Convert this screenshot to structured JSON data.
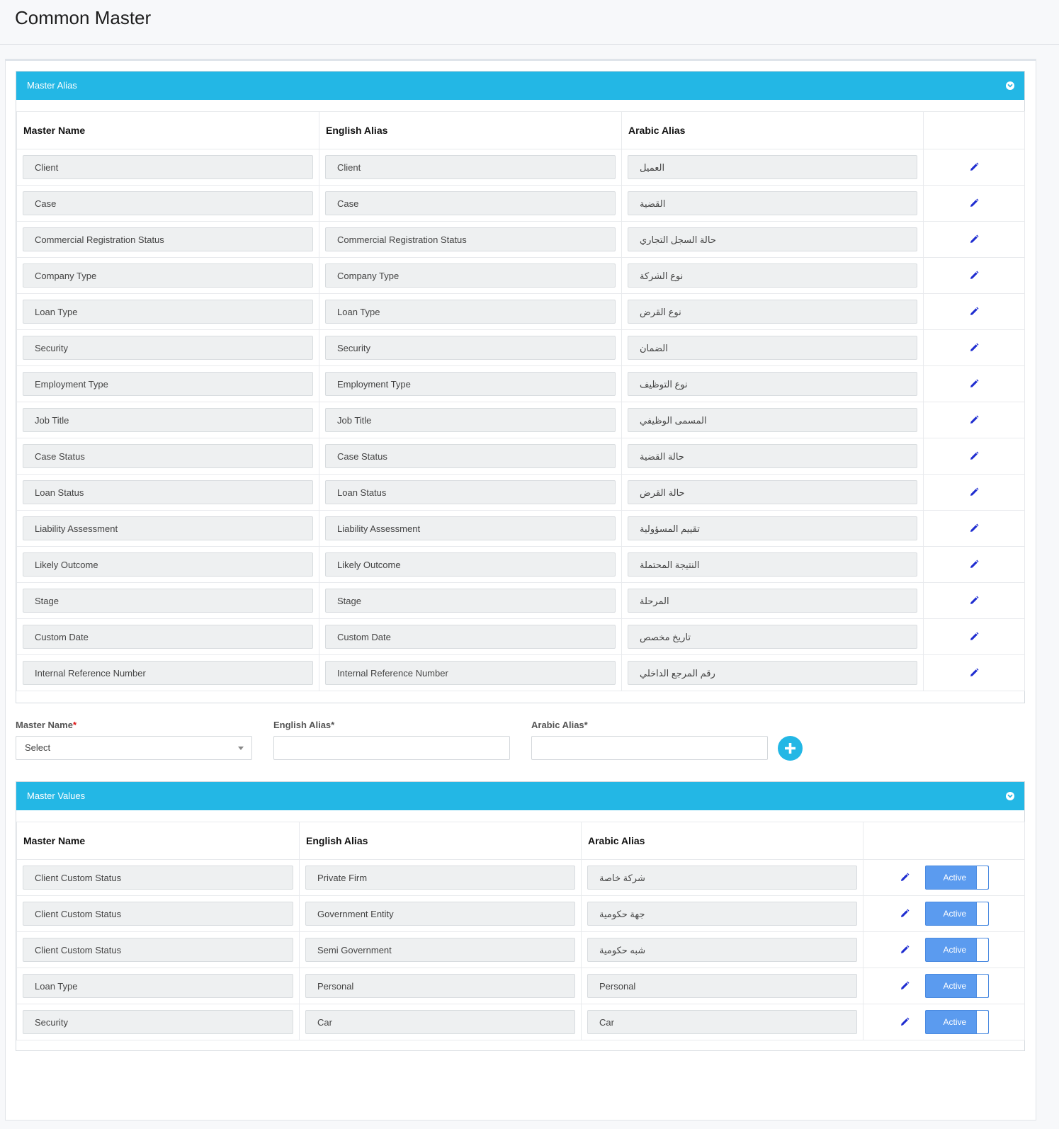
{
  "page": {
    "title": "Common Master"
  },
  "colors": {
    "accent": "#23b7e5",
    "toggle": "#5b9bef",
    "edit_icon": "#1f2dd0"
  },
  "alias_panel": {
    "title": "Master Alias",
    "headers": [
      "Master Name",
      "English Alias",
      "Arabic Alias",
      ""
    ],
    "rows": [
      {
        "master": "Client",
        "english": "Client",
        "arabic": "العميل"
      },
      {
        "master": "Case",
        "english": "Case",
        "arabic": "القضية"
      },
      {
        "master": "Commercial Registration Status",
        "english": "Commercial Registration Status",
        "arabic": "حالة السجل التجاري"
      },
      {
        "master": "Company Type",
        "english": "Company Type",
        "arabic": "نوع الشركة"
      },
      {
        "master": "Loan Type",
        "english": "Loan Type",
        "arabic": "نوع القرض"
      },
      {
        "master": "Security",
        "english": "Security",
        "arabic": "الضمان"
      },
      {
        "master": "Employment Type",
        "english": "Employment Type",
        "arabic": "نوع التوظيف"
      },
      {
        "master": "Job Title",
        "english": "Job Title",
        "arabic": "المسمى الوظيفي"
      },
      {
        "master": "Case Status",
        "english": "Case Status",
        "arabic": "حالة القضية"
      },
      {
        "master": "Loan Status",
        "english": "Loan Status",
        "arabic": "حالة القرض"
      },
      {
        "master": "Liability Assessment",
        "english": "Liability Assessment",
        "arabic": "تقييم المسؤولية"
      },
      {
        "master": "Likely Outcome",
        "english": "Likely Outcome",
        "arabic": "النتيجة المحتملة"
      },
      {
        "master": "Stage",
        "english": "Stage",
        "arabic": "المرحلة"
      },
      {
        "master": "Custom Date",
        "english": "Custom Date",
        "arabic": "تاريخ مخصص"
      },
      {
        "master": "Internal Reference Number",
        "english": "Internal Reference Number",
        "arabic": "رقم المرجع الداخلي"
      }
    ]
  },
  "form": {
    "master_label": "Master Name",
    "master_required": "*",
    "master_value": "Select",
    "english_label": "English Alias*",
    "english_value": "",
    "arabic_label": "Arabic Alias*",
    "arabic_value": "",
    "add_icon": "plus-circle-icon"
  },
  "values_panel": {
    "title": "Master Values",
    "headers": [
      "Master Name",
      "English Alias",
      "Arabic Alias",
      ""
    ],
    "rows": [
      {
        "master": "Client Custom Status",
        "english": "Private Firm",
        "arabic": "شركة خاصة",
        "status": "Active"
      },
      {
        "master": "Client Custom Status",
        "english": "Government Entity",
        "arabic": "جهة حكومية",
        "status": "Active"
      },
      {
        "master": "Client Custom Status",
        "english": "Semi Government",
        "arabic": "شبه حكومية",
        "status": "Active"
      },
      {
        "master": "Loan Type",
        "english": "Personal",
        "arabic": "Personal",
        "status": "Active"
      },
      {
        "master": "Security",
        "english": "Car",
        "arabic": "Car",
        "status": "Active"
      }
    ]
  }
}
